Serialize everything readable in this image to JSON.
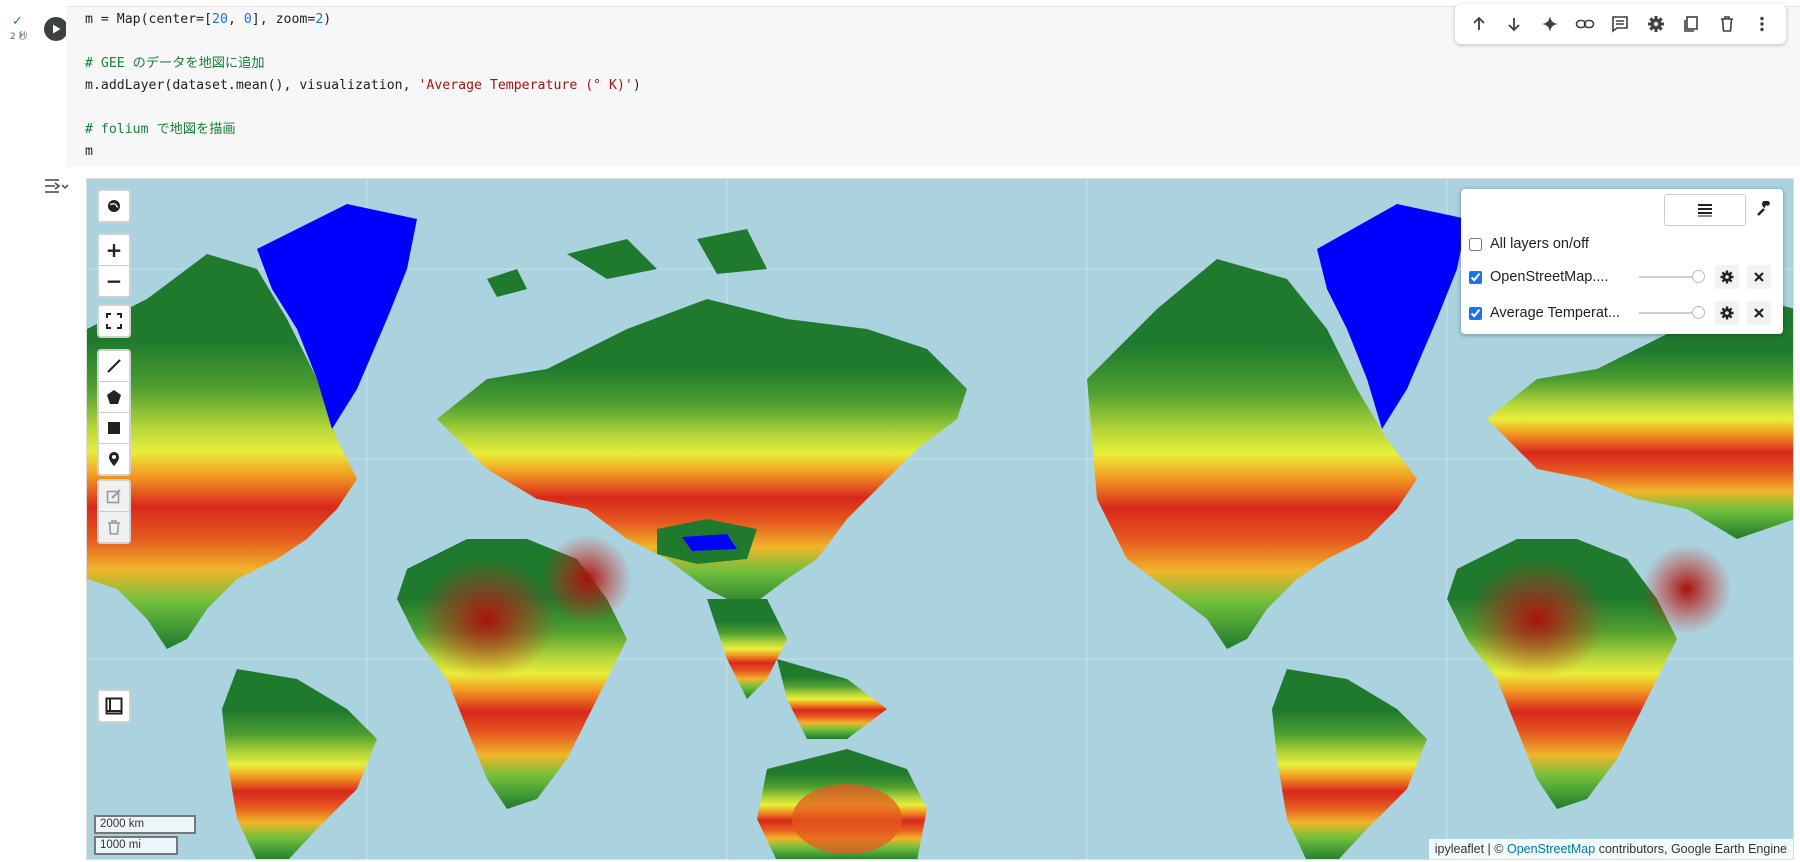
{
  "cell": {
    "status_check": "✓",
    "elapsed": "2 秒",
    "code_lines": [
      "m = Map(center=[20, 0], zoom=2)",
      "",
      "# GEE のデータを地図に追加",
      "m.addLayer(dataset.mean(), visualization, 'Average Temperature (° K)')",
      "",
      "# folium で地図を描画",
      "m"
    ]
  },
  "toolbar": {
    "buttons": [
      "arrow-up",
      "arrow-down",
      "sparkle",
      "link",
      "comment",
      "settings",
      "mirror-cell",
      "delete",
      "more"
    ]
  },
  "map": {
    "layer_panel": {
      "all_layers_label": "All layers on/off",
      "all_layers_checked": false,
      "layers": [
        {
          "name": "OpenStreetMap....",
          "checked": true,
          "opacity": 1.0
        },
        {
          "name": "Average Temperat...",
          "checked": true,
          "opacity": 1.0
        }
      ]
    },
    "zoom_in": "+",
    "zoom_out": "−",
    "scale_km": "2000 km",
    "scale_mi": "1000 mi",
    "attribution_prefix": "ipyleaflet | © ",
    "attribution_link": "OpenStreetMap",
    "attribution_suffix": " contributors, Google Earth Engine",
    "colors": {
      "ocean": "#aad3df",
      "ice": "#0000ff",
      "cold": "#1f7a2e",
      "cool": "#6fbf3c",
      "mild": "#e9ee3a",
      "warm": "#f39a23",
      "hot": "#d8281c",
      "hottest": "#a5120d"
    }
  }
}
